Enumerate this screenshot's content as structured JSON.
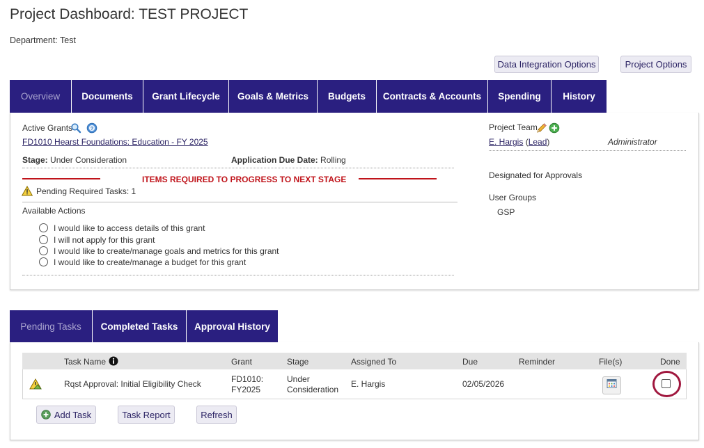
{
  "page": {
    "title": "Project Dashboard: TEST PROJECT",
    "department_label": "Department:",
    "department_value": "Test"
  },
  "top_buttons": {
    "data_integration": "Data Integration Options",
    "project_options": "Project Options"
  },
  "main_tabs": [
    {
      "label": "Overview"
    },
    {
      "label": "Documents"
    },
    {
      "label": "Grant Lifecycle"
    },
    {
      "label": "Goals & Metrics"
    },
    {
      "label": "Budgets"
    },
    {
      "label": "Contracts & Accounts"
    },
    {
      "label": "Spending"
    },
    {
      "label": "History"
    }
  ],
  "overview": {
    "active_grants_label": "Active Grants",
    "grant_link": "FD1010 Hearst Foundations: Education - FY 2025",
    "stage_label": "Stage:",
    "stage_value": "Under Consideration",
    "due_label": "Application Due Date:",
    "due_value": "Rolling",
    "required_banner": "ITEMS REQUIRED TO PROGRESS TO NEXT STAGE",
    "pending_required": "Pending Required Tasks: 1",
    "available_actions_label": "Available Actions",
    "actions": [
      "I would like to access details of this grant",
      "I will not apply for this grant",
      "I would like to create/manage goals and metrics for this grant",
      "I would like to create/manage a budget for this grant"
    ],
    "project_team_label": "Project Team",
    "member_name": "E. Hargis",
    "member_role_link": "Lead",
    "member_role": "Administrator",
    "designated_label": "Designated for Approvals",
    "user_groups_label": "User Groups",
    "user_group": "GSP"
  },
  "task_tabs": [
    {
      "label": "Pending Tasks"
    },
    {
      "label": "Completed Tasks"
    },
    {
      "label": "Approval History"
    }
  ],
  "tasks": {
    "columns": [
      "Task Name",
      "Grant",
      "Stage",
      "Assigned To",
      "Due",
      "Reminder",
      "File(s)",
      "Done"
    ],
    "rows": [
      {
        "task_name": "Rqst Approval: Initial Eligibility Check",
        "grant_line1": "FD1010:",
        "grant_line2": "FY2025",
        "stage_line1": "Under",
        "stage_line2": "Consideration",
        "assigned_to": "E. Hargis",
        "due": "02/05/2026",
        "reminder": ""
      }
    ],
    "add_task": "Add Task",
    "task_report": "Task Report",
    "refresh": "Refresh"
  },
  "colors": {
    "tab_bg": "#2a1f80",
    "accent_red": "#c0141b",
    "highlight_ring": "#a0173e",
    "link": "#2b2364"
  },
  "icons": {
    "search": "search-icon",
    "help": "help-icon",
    "warning": "warning-icon",
    "edit": "pencil-icon",
    "add": "plus-circle-icon",
    "info": "info-icon",
    "task_alert": "task-warning-icon",
    "file": "calendar-file-icon"
  }
}
